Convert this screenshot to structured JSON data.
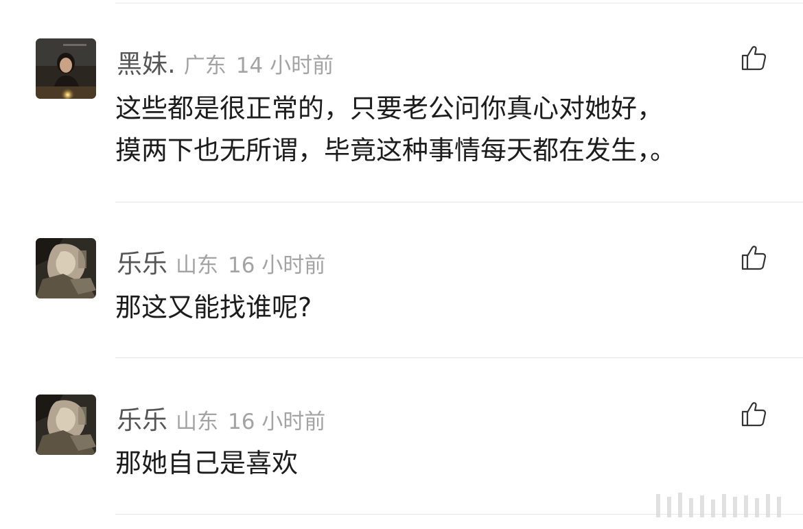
{
  "comments": [
    {
      "username": "黑妹.",
      "region": "广东",
      "time": "14 小时前",
      "text": "这些都是很正常的，只要老公问你真心对她好，\n摸两下也无所谓，毕竟这种事情每天都在发生，。",
      "avatar_icon": "avatar-photo-girl-candle"
    },
    {
      "username": "乐乐",
      "region": "山东",
      "time": "16 小时前",
      "text": "那这又能找谁呢?",
      "avatar_icon": "avatar-photo-dark-figure"
    },
    {
      "username": "乐乐",
      "region": "山东",
      "time": "16 小时前",
      "text": "那她自己是喜欢",
      "avatar_icon": "avatar-photo-dark-figure"
    }
  ],
  "like_icon": "thumbs-up-icon",
  "colors": {
    "username": "#555555",
    "meta": "#a3a3a3",
    "text": "#1c1c1c",
    "divider": "#e6e6e6"
  }
}
